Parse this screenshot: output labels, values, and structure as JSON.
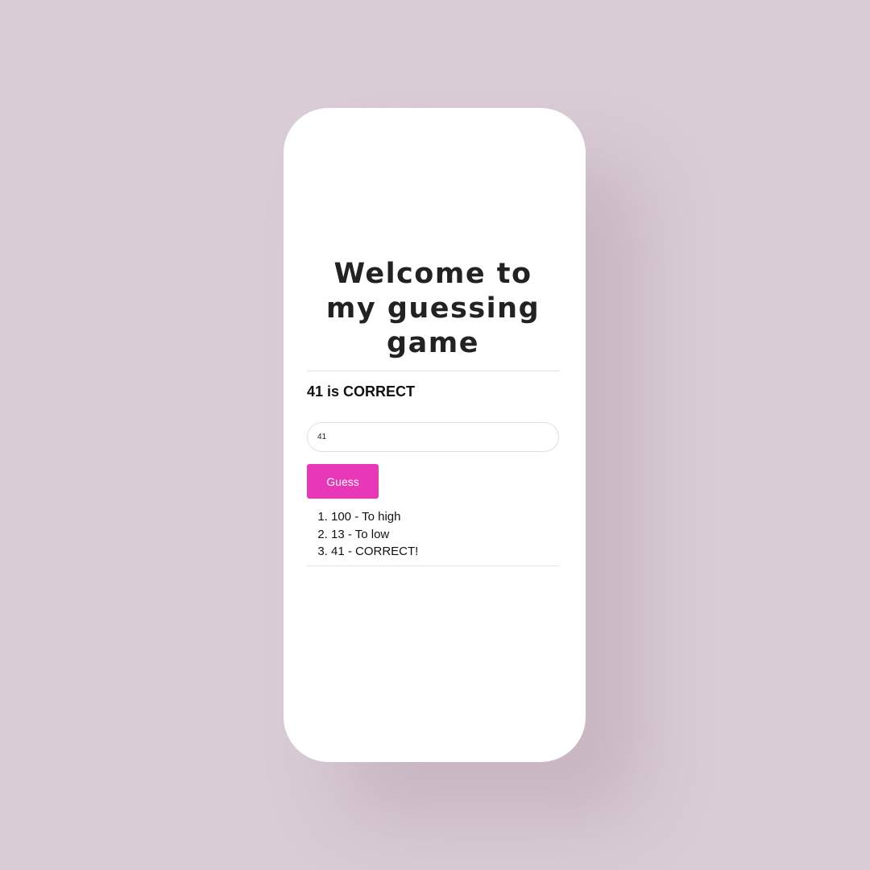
{
  "title": "Welcome to my guessing game",
  "status": "41 is CORRECT",
  "guess_input": {
    "value": "41",
    "placeholder": ""
  },
  "guess_button": {
    "label": "Guess"
  },
  "history": [
    "100 - To high",
    "13 - To low",
    "41 - CORRECT!"
  ],
  "colors": {
    "background": "#d9ccd6",
    "card": "#ffffff",
    "accent": "#e838b8",
    "title_text": "#222222"
  }
}
